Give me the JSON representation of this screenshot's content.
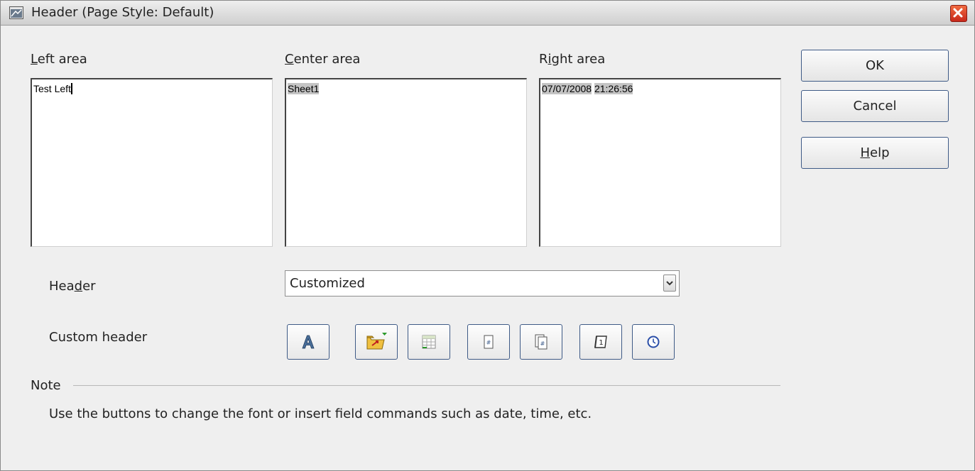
{
  "window": {
    "title": "Header (Page Style: Default)"
  },
  "areas": {
    "left": {
      "label_pre": "",
      "label_u": "L",
      "label_post": "eft area",
      "content": "Test Left"
    },
    "center": {
      "label_pre": "",
      "label_u": "C",
      "label_post": "enter area",
      "content": "Sheet1"
    },
    "right": {
      "label_pre": "R",
      "label_u": "i",
      "label_post": "ght area",
      "content_date": "07/07/2008",
      "content_time": "21:26:56"
    }
  },
  "buttons": {
    "ok": "OK",
    "cancel": "Cancel",
    "help_u": "H",
    "help_post": "elp"
  },
  "header_select": {
    "label_pre": "Hea",
    "label_u": "d",
    "label_post": "er",
    "value": "Customized"
  },
  "custom_header": {
    "label": "Custom header",
    "tools": [
      "text-attributes",
      "file-name",
      "sheet-name",
      "page",
      "pages",
      "date",
      "time"
    ]
  },
  "note": {
    "label": "Note",
    "text": "Use the buttons to change the font or insert field commands such as date, time, etc."
  }
}
